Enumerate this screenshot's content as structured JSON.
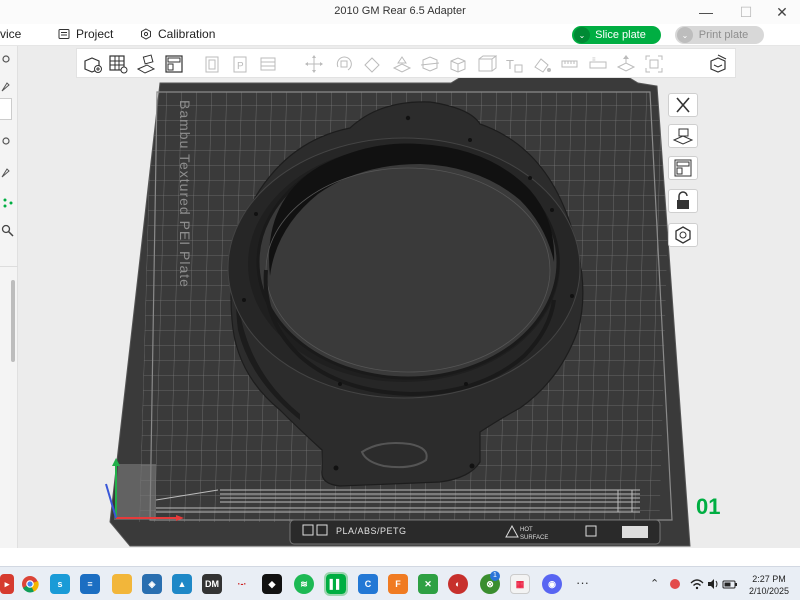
{
  "window": {
    "title": "2010 GM Rear 6.5 Adapter",
    "minimize_glyph": "—",
    "maximize_glyph": "☐",
    "close_glyph": "✕"
  },
  "menubar": {
    "device_label": "vice",
    "project_label": "Project",
    "calibration_label": "Calibration",
    "slice_label": "Slice plate",
    "print_label": "Print plate",
    "dropdown_glyph": "⌄"
  },
  "plate": {
    "vertical_label": "Bambu Textured PEI Plate",
    "material_label": "PLA/ABS/PETG",
    "warning_label_1": "HOT",
    "warning_label_2": "SURFACE",
    "plate_number": "01"
  },
  "colors": {
    "accent": "#00ae42",
    "plate": "#3a3a3a",
    "grid": "#6a6a6a",
    "model": "#2b2b2b"
  },
  "taskbar": {
    "tray_up_glyph": "⌃",
    "more_glyph": "···",
    "badge_count": "1",
    "time": "2:27 PM",
    "date": "2/10/2025"
  }
}
